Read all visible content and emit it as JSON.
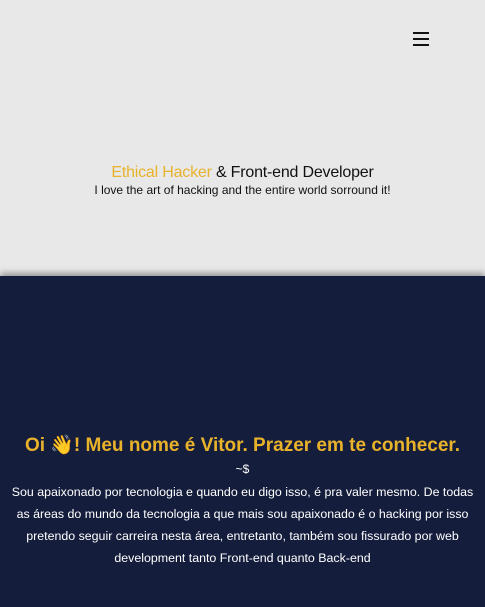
{
  "header": {
    "menu_icon": "hamburger-menu-icon"
  },
  "hero": {
    "title_accent": "Ethical Hacker",
    "title_rest": " & Front-end Developer",
    "subtitle": "I love the art of hacking and the entire world sorround it!"
  },
  "about": {
    "title": "Oi 👋! Meu nome é Vitor. Prazer em te conhecer.",
    "prompt": "~$",
    "body": "Sou apaixonado por tecnologia e quando eu digo isso, é pra valer mesmo. De todas as áreas do mundo da tecnologia a que mais sou apaixonado é o hacking por isso pretendo seguir carreira nesta área, entretanto, também sou fissurado por web development tanto Front-end quanto Back-end"
  },
  "colors": {
    "accent": "#e8b22b",
    "hero_bg": "#e8e8e8",
    "about_bg": "#151d3c"
  }
}
